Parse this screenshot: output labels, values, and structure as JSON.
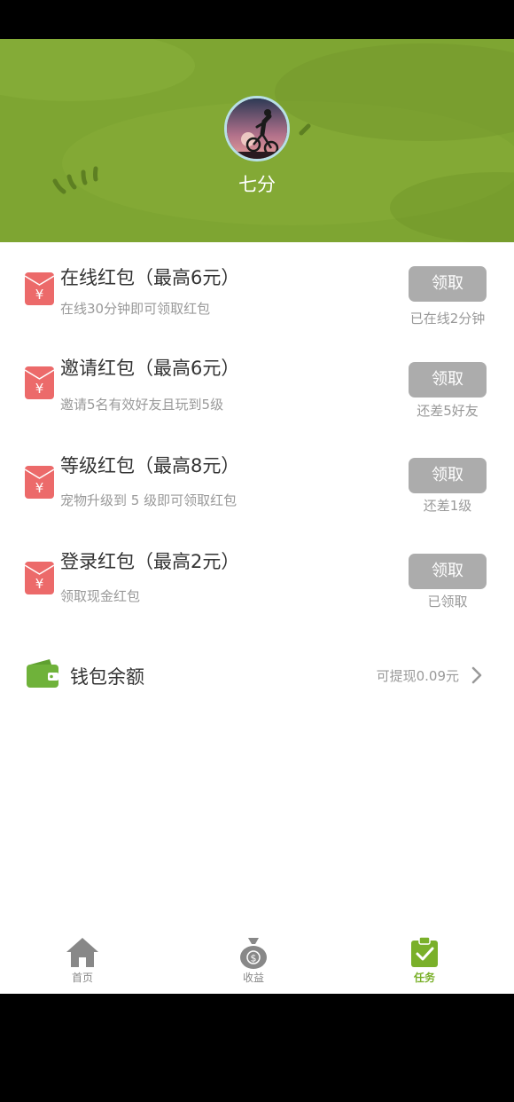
{
  "profile": {
    "username": "七分"
  },
  "tasks": [
    {
      "title": "在线红包（最高6元）",
      "desc": "在线30分钟即可领取红包",
      "button": "领取",
      "status": "已在线2分钟"
    },
    {
      "title": "邀请红包（最高6元）",
      "desc": "邀请5名有效好友且玩到5级",
      "button": "领取",
      "status": "还差5好友"
    },
    {
      "title": "等级红包（最高8元）",
      "desc": "宠物升级到  5 级即可领取红包",
      "button": "领取",
      "status": "还差1级"
    },
    {
      "title": "登录红包（最高2元）",
      "desc": "领取现金红包",
      "button": "领取",
      "status": "已领取"
    }
  ],
  "wallet": {
    "label": "钱包余额",
    "amount": "可提现0.09元"
  },
  "tabbar": {
    "items": [
      {
        "label": "首页",
        "icon": "home-icon"
      },
      {
        "label": "收益",
        "icon": "money-bag-icon"
      },
      {
        "label": "任务",
        "icon": "task-clipboard-icon"
      }
    ],
    "active": "任务"
  },
  "colors": {
    "header_green": "#7ea532",
    "accent_green": "#7ab02a",
    "red_envelope": "#ec6a6a",
    "button_gray": "#acacac"
  }
}
